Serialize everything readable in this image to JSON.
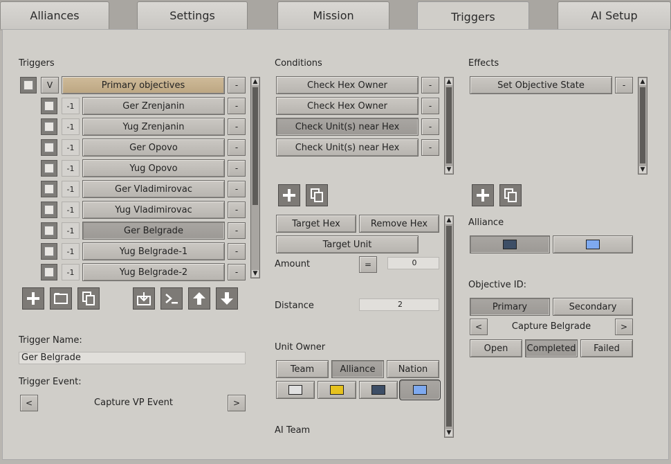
{
  "tabs": [
    {
      "label": "Alliances"
    },
    {
      "label": "Settings"
    },
    {
      "label": "Mission"
    },
    {
      "label": "Triggers"
    },
    {
      "label": "AI Setup"
    }
  ],
  "active_tab": "Triggers",
  "triggers": {
    "heading": "Triggers",
    "header_row": {
      "toggle_label": "V",
      "label": "Primary objectives",
      "minus": "-"
    },
    "rows": [
      {
        "num": "-1",
        "label": "Ger Zrenjanin",
        "minus": "-"
      },
      {
        "num": "-1",
        "label": "Yug Zrenjanin",
        "minus": "-"
      },
      {
        "num": "-1",
        "label": "Ger Opovo",
        "minus": "-"
      },
      {
        "num": "-1",
        "label": "Yug Opovo",
        "minus": "-"
      },
      {
        "num": "-1",
        "label": "Ger Vladimirovac",
        "minus": "-"
      },
      {
        "num": "-1",
        "label": "Yug Vladimirovac",
        "minus": "-"
      },
      {
        "num": "-1",
        "label": "Ger Belgrade",
        "minus": "-"
      },
      {
        "num": "-1",
        "label": "Yug Belgrade-1",
        "minus": "-"
      },
      {
        "num": "-1",
        "label": "Yug Belgrade-2",
        "minus": "-"
      }
    ],
    "name_label": "Trigger Name:",
    "name_value": "Ger Belgrade",
    "event_label": "Trigger Event:",
    "event_value": "Capture VP Event",
    "prev": "<",
    "next": ">"
  },
  "conditions": {
    "heading": "Conditions",
    "items": [
      {
        "label": "Check Hex Owner",
        "minus": "-"
      },
      {
        "label": "Check Hex Owner",
        "minus": "-"
      },
      {
        "label": "Check Unit(s) near Hex",
        "minus": "-"
      },
      {
        "label": "Check Unit(s) near Hex",
        "minus": "-"
      }
    ],
    "target_hex": "Target Hex",
    "remove_hex": "Remove Hex",
    "target_unit": "Target Unit",
    "amount_label": "Amount",
    "amount_op": "=",
    "amount_value": "0",
    "distance_label": "Distance",
    "distance_value": "2",
    "unit_owner_label": "Unit Owner",
    "owner_tabs": [
      "Team",
      "Alliance",
      "Nation"
    ],
    "ai_team_label": "AI Team"
  },
  "effects": {
    "heading": "Effects",
    "items": [
      {
        "label": "Set Objective State",
        "minus": "-"
      }
    ],
    "alliance_label": "Alliance",
    "objective_id_label": "Objective ID:",
    "objective_tabs": [
      "Primary",
      "Secondary"
    ],
    "objective_name": "Capture Belgrade",
    "prev": "<",
    "next": ">",
    "states": [
      "Open",
      "Completed",
      "Failed"
    ]
  },
  "colors": {
    "panel": "#d0cec9",
    "swatch_white": "#e0e0e0",
    "swatch_yellow": "#e6c21e",
    "swatch_navy": "#3d4e66",
    "swatch_blue": "#7ea9ef"
  }
}
